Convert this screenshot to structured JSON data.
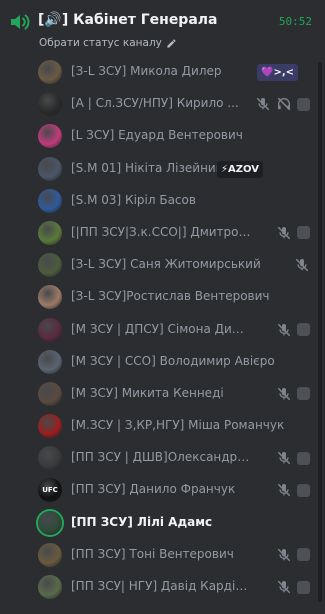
{
  "header": {
    "channel_name": "[🔊] Кабінет Генерала",
    "timer": "50:52",
    "status_prompt": "Обрати статус каналу"
  },
  "users": [
    {
      "name": "[З-L ЗСУ] Микола Дилер",
      "avatar_color": "#6b5a44",
      "tag": "💜>,<",
      "icons": []
    },
    {
      "name": "[A | Сл.ЗСУ/НПУ] Кирило ...",
      "avatar_color": "#2a2a2a",
      "tag": "",
      "icons": [
        "muted-icon",
        "deafened-icon",
        "box"
      ]
    },
    {
      "name": "[L ЗСУ] Едуард Вентерович",
      "avatar_color": "#c23b7a",
      "tag": "",
      "icons": []
    },
    {
      "name": "[S.M 01] Нікіта Лізейник",
      "avatar_color": "#4a5566",
      "tag": "⚡AZOV",
      "icons": []
    },
    {
      "name": "[S.M 03] Кіріл Басов",
      "avatar_color": "#2f5a9a",
      "tag": "",
      "icons": []
    },
    {
      "name": "[|ПП ЗСУ|З.к.ССО|] Дмитро К...",
      "avatar_color": "#5b7a3a",
      "tag": "",
      "icons": [
        "muted-icon",
        "box"
      ]
    },
    {
      "name": "[З-L ЗСУ] Саня Житомирський",
      "avatar_color": "#4c5c3c",
      "tag": "",
      "icons": [
        "muted-icon"
      ]
    },
    {
      "name": "[З-L ЗСУ]Ростислав Вентерович",
      "avatar_color": "#9a7a66",
      "tag": "",
      "icons": []
    },
    {
      "name": "[М ЗСУ | ДПСУ] Сімона Дилер",
      "avatar_color": "#5a2a3e",
      "tag": "",
      "icons": [
        "muted-icon",
        "box"
      ]
    },
    {
      "name": "[М ЗСУ | ССО] Володимир Авієро",
      "avatar_color": "#5a6470",
      "tag": "",
      "icons": []
    },
    {
      "name": "[М ЗСУ] Микита Кеннеді",
      "avatar_color": "#5a4a3e",
      "tag": "",
      "icons": [
        "muted-icon",
        "box"
      ]
    },
    {
      "name": "[М.ЗСУ | З,КР,НГУ] Міша Романчук",
      "avatar_color": "#9a1e1e",
      "tag": "",
      "icons": []
    },
    {
      "name": "[ПП ЗСУ | ДШВ]Олександр Сирс...",
      "avatar_color": "#3a3a3a",
      "tag": "",
      "icons": [
        "muted-icon",
        "box"
      ]
    },
    {
      "name": "[ПП ЗСУ] Данило Франчук",
      "avatar_color": "#111111",
      "avatar_text": "UFC",
      "tag": "",
      "icons": [
        "muted-icon",
        "box"
      ]
    },
    {
      "name": "[ПП ЗСУ] Лілі Адамс",
      "avatar_color": "#2e4a3a",
      "tag": "",
      "icons": [],
      "active": true
    },
    {
      "name": "[ПП ЗСУ] Тоні Вентерович",
      "avatar_color": "#6a5a3e",
      "tag": "",
      "icons": [
        "muted-icon",
        "box"
      ]
    },
    {
      "name": "[ПП ЗСУ| НГУ] Давід Кардіналов",
      "avatar_color": "#5a6a4a",
      "tag": "",
      "icons": [
        "muted-icon",
        "box"
      ]
    }
  ]
}
